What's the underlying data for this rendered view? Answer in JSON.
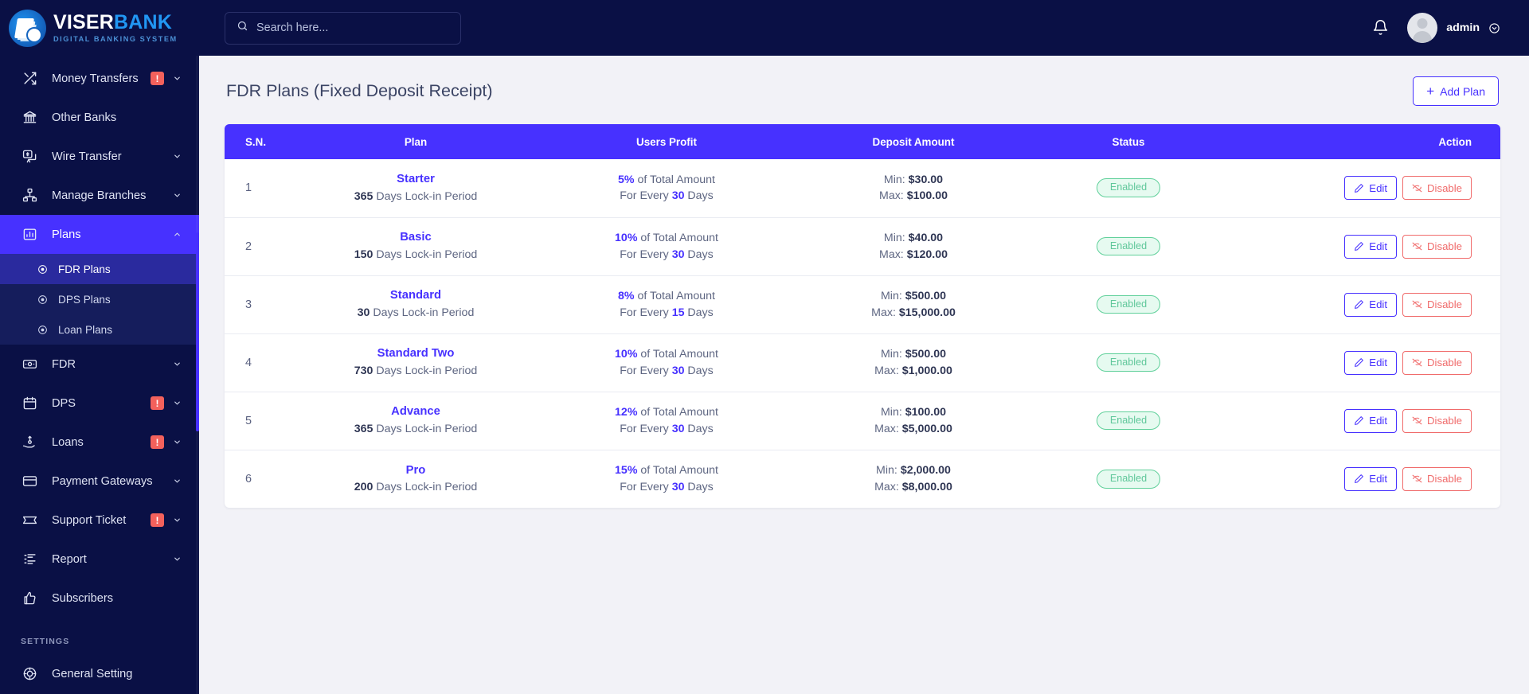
{
  "brand": {
    "name_part1": "VISER",
    "name_part2": "BANK",
    "tagline": "DIGITAL BANKING SYSTEM",
    "accent": "#2196f3"
  },
  "search": {
    "placeholder": "Search here...",
    "value": ""
  },
  "topbar": {
    "user_name": "admin"
  },
  "sidebar": {
    "settings_heading": "SETTINGS",
    "items": [
      {
        "label": "Money Transfers",
        "icon": "shuffle-icon",
        "alert": "!",
        "has_chevron": true,
        "active": false
      },
      {
        "label": "Other Banks",
        "icon": "bank-icon",
        "alert": "",
        "has_chevron": false,
        "active": false
      },
      {
        "label": "Wire Transfer",
        "icon": "wire-transfer-icon",
        "alert": "",
        "has_chevron": true,
        "active": false
      },
      {
        "label": "Manage Branches",
        "icon": "branches-icon",
        "alert": "",
        "has_chevron": true,
        "active": false
      },
      {
        "label": "Plans",
        "icon": "chart-bar-icon",
        "alert": "",
        "has_chevron": true,
        "active": true
      },
      {
        "label": "FDR",
        "icon": "money-icon",
        "alert": "",
        "has_chevron": true,
        "active": false
      },
      {
        "label": "DPS",
        "icon": "calendar-icon",
        "alert": "!",
        "has_chevron": true,
        "active": false
      },
      {
        "label": "Loans",
        "icon": "hand-money-icon",
        "alert": "!",
        "has_chevron": true,
        "active": false
      },
      {
        "label": "Payment Gateways",
        "icon": "credit-card-icon",
        "alert": "",
        "has_chevron": true,
        "active": false
      },
      {
        "label": "Support Ticket",
        "icon": "ticket-icon",
        "alert": "!",
        "has_chevron": true,
        "active": false
      },
      {
        "label": "Report",
        "icon": "list-icon",
        "alert": "",
        "has_chevron": true,
        "active": false
      },
      {
        "label": "Subscribers",
        "icon": "thumbs-up-icon",
        "alert": "",
        "has_chevron": false,
        "active": false
      }
    ],
    "submenu": [
      {
        "label": "FDR Plans",
        "active": true
      },
      {
        "label": "DPS Plans",
        "active": false
      },
      {
        "label": "Loan Plans",
        "active": false
      }
    ],
    "settings_items": [
      {
        "label": "General Setting",
        "icon": "gear-icon"
      }
    ]
  },
  "page": {
    "title": "FDR Plans (Fixed Deposit Receipt)",
    "add_button": "Add Plan",
    "add_button_plus": "+"
  },
  "table": {
    "columns": [
      "S.N.",
      "Plan",
      "Users Profit",
      "Deposit Amount",
      "Status",
      "Action"
    ],
    "labels": {
      "lockin_suffix": "Days Lock-in Period",
      "profit_suffix": "of Total Amount",
      "every_prefix": "For Every",
      "days_suffix": "Days",
      "min_prefix": "Min:",
      "max_prefix": "Max:",
      "edit": "Edit",
      "disable": "Disable"
    },
    "rows": [
      {
        "sn": "1",
        "plan": "Starter",
        "lockin_days": "365",
        "profit_pct": "5%",
        "every_days": "30",
        "min": "$30.00",
        "max": "$100.00",
        "status": "Enabled"
      },
      {
        "sn": "2",
        "plan": "Basic",
        "lockin_days": "150",
        "profit_pct": "10%",
        "every_days": "30",
        "min": "$40.00",
        "max": "$120.00",
        "status": "Enabled"
      },
      {
        "sn": "3",
        "plan": "Standard",
        "lockin_days": "30",
        "profit_pct": "8%",
        "every_days": "15",
        "min": "$500.00",
        "max": "$15,000.00",
        "status": "Enabled"
      },
      {
        "sn": "4",
        "plan": "Standard Two",
        "lockin_days": "730",
        "profit_pct": "10%",
        "every_days": "30",
        "min": "$500.00",
        "max": "$1,000.00",
        "status": "Enabled"
      },
      {
        "sn": "5",
        "plan": "Advance",
        "lockin_days": "365",
        "profit_pct": "12%",
        "every_days": "30",
        "min": "$100.00",
        "max": "$5,000.00",
        "status": "Enabled"
      },
      {
        "sn": "6",
        "plan": "Pro",
        "lockin_days": "200",
        "profit_pct": "15%",
        "every_days": "30",
        "min": "$2,000.00",
        "max": "$8,000.00",
        "status": "Enabled"
      }
    ]
  },
  "colors": {
    "primary": "#4731ff",
    "sidebar_bg": "#0a1045",
    "alert": "#f3615c",
    "success": "#5fc79a",
    "danger": "#f06b6b"
  }
}
